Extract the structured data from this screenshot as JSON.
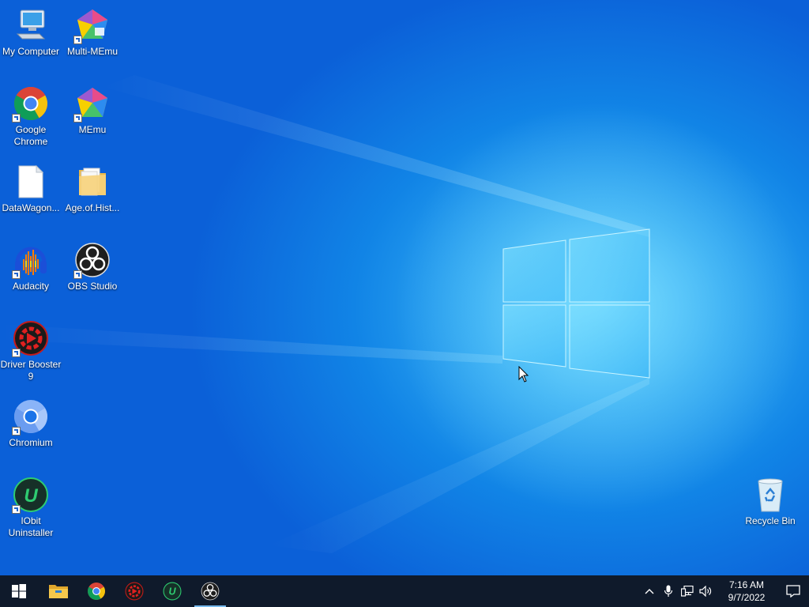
{
  "desktop": {
    "icons": [
      {
        "label": "My Computer",
        "icon": "computer-icon"
      },
      {
        "label": "Multi-MEmu",
        "icon": "multi-memu-icon"
      },
      {
        "label": "Google Chrome",
        "icon": "chrome-icon"
      },
      {
        "label": "MEmu",
        "icon": "memu-icon"
      },
      {
        "label": "DataWagon...",
        "icon": "document-icon"
      },
      {
        "label": "Age.of.Hist...",
        "icon": "folder-icon"
      },
      {
        "label": "Audacity",
        "icon": "audacity-icon"
      },
      {
        "label": "OBS Studio",
        "icon": "obs-icon"
      },
      {
        "label": "Driver Booster 9",
        "icon": "driver-booster-icon"
      },
      {
        "label": "Chromium",
        "icon": "chromium-icon"
      },
      {
        "label": "IObit Uninstaller",
        "icon": "iobit-uninstaller-icon"
      },
      {
        "label": "Recycle Bin",
        "icon": "recycle-bin-icon"
      }
    ]
  },
  "taskbar": {
    "pinned": [
      {
        "name": "start",
        "icon": "windows-start-icon"
      },
      {
        "name": "file-explorer",
        "icon": "file-explorer-icon"
      },
      {
        "name": "chrome",
        "icon": "chrome-icon"
      },
      {
        "name": "driver-booster",
        "icon": "driver-booster-icon"
      },
      {
        "name": "iobit-uninstaller",
        "icon": "iobit-uninstaller-icon"
      },
      {
        "name": "obs-studio",
        "icon": "obs-icon",
        "active": true
      }
    ],
    "tray": {
      "icons": [
        "chevron-up-icon",
        "microphone-icon",
        "network-icon",
        "volume-icon"
      ],
      "time": "7:16 AM",
      "date": "9/7/2022"
    }
  },
  "colors": {
    "taskbar": "#0f1a2b",
    "wallpaper_dark": "#0b5fd4",
    "wallpaper_light": "#5fd2ff",
    "active_indicator": "#76b9ed"
  }
}
